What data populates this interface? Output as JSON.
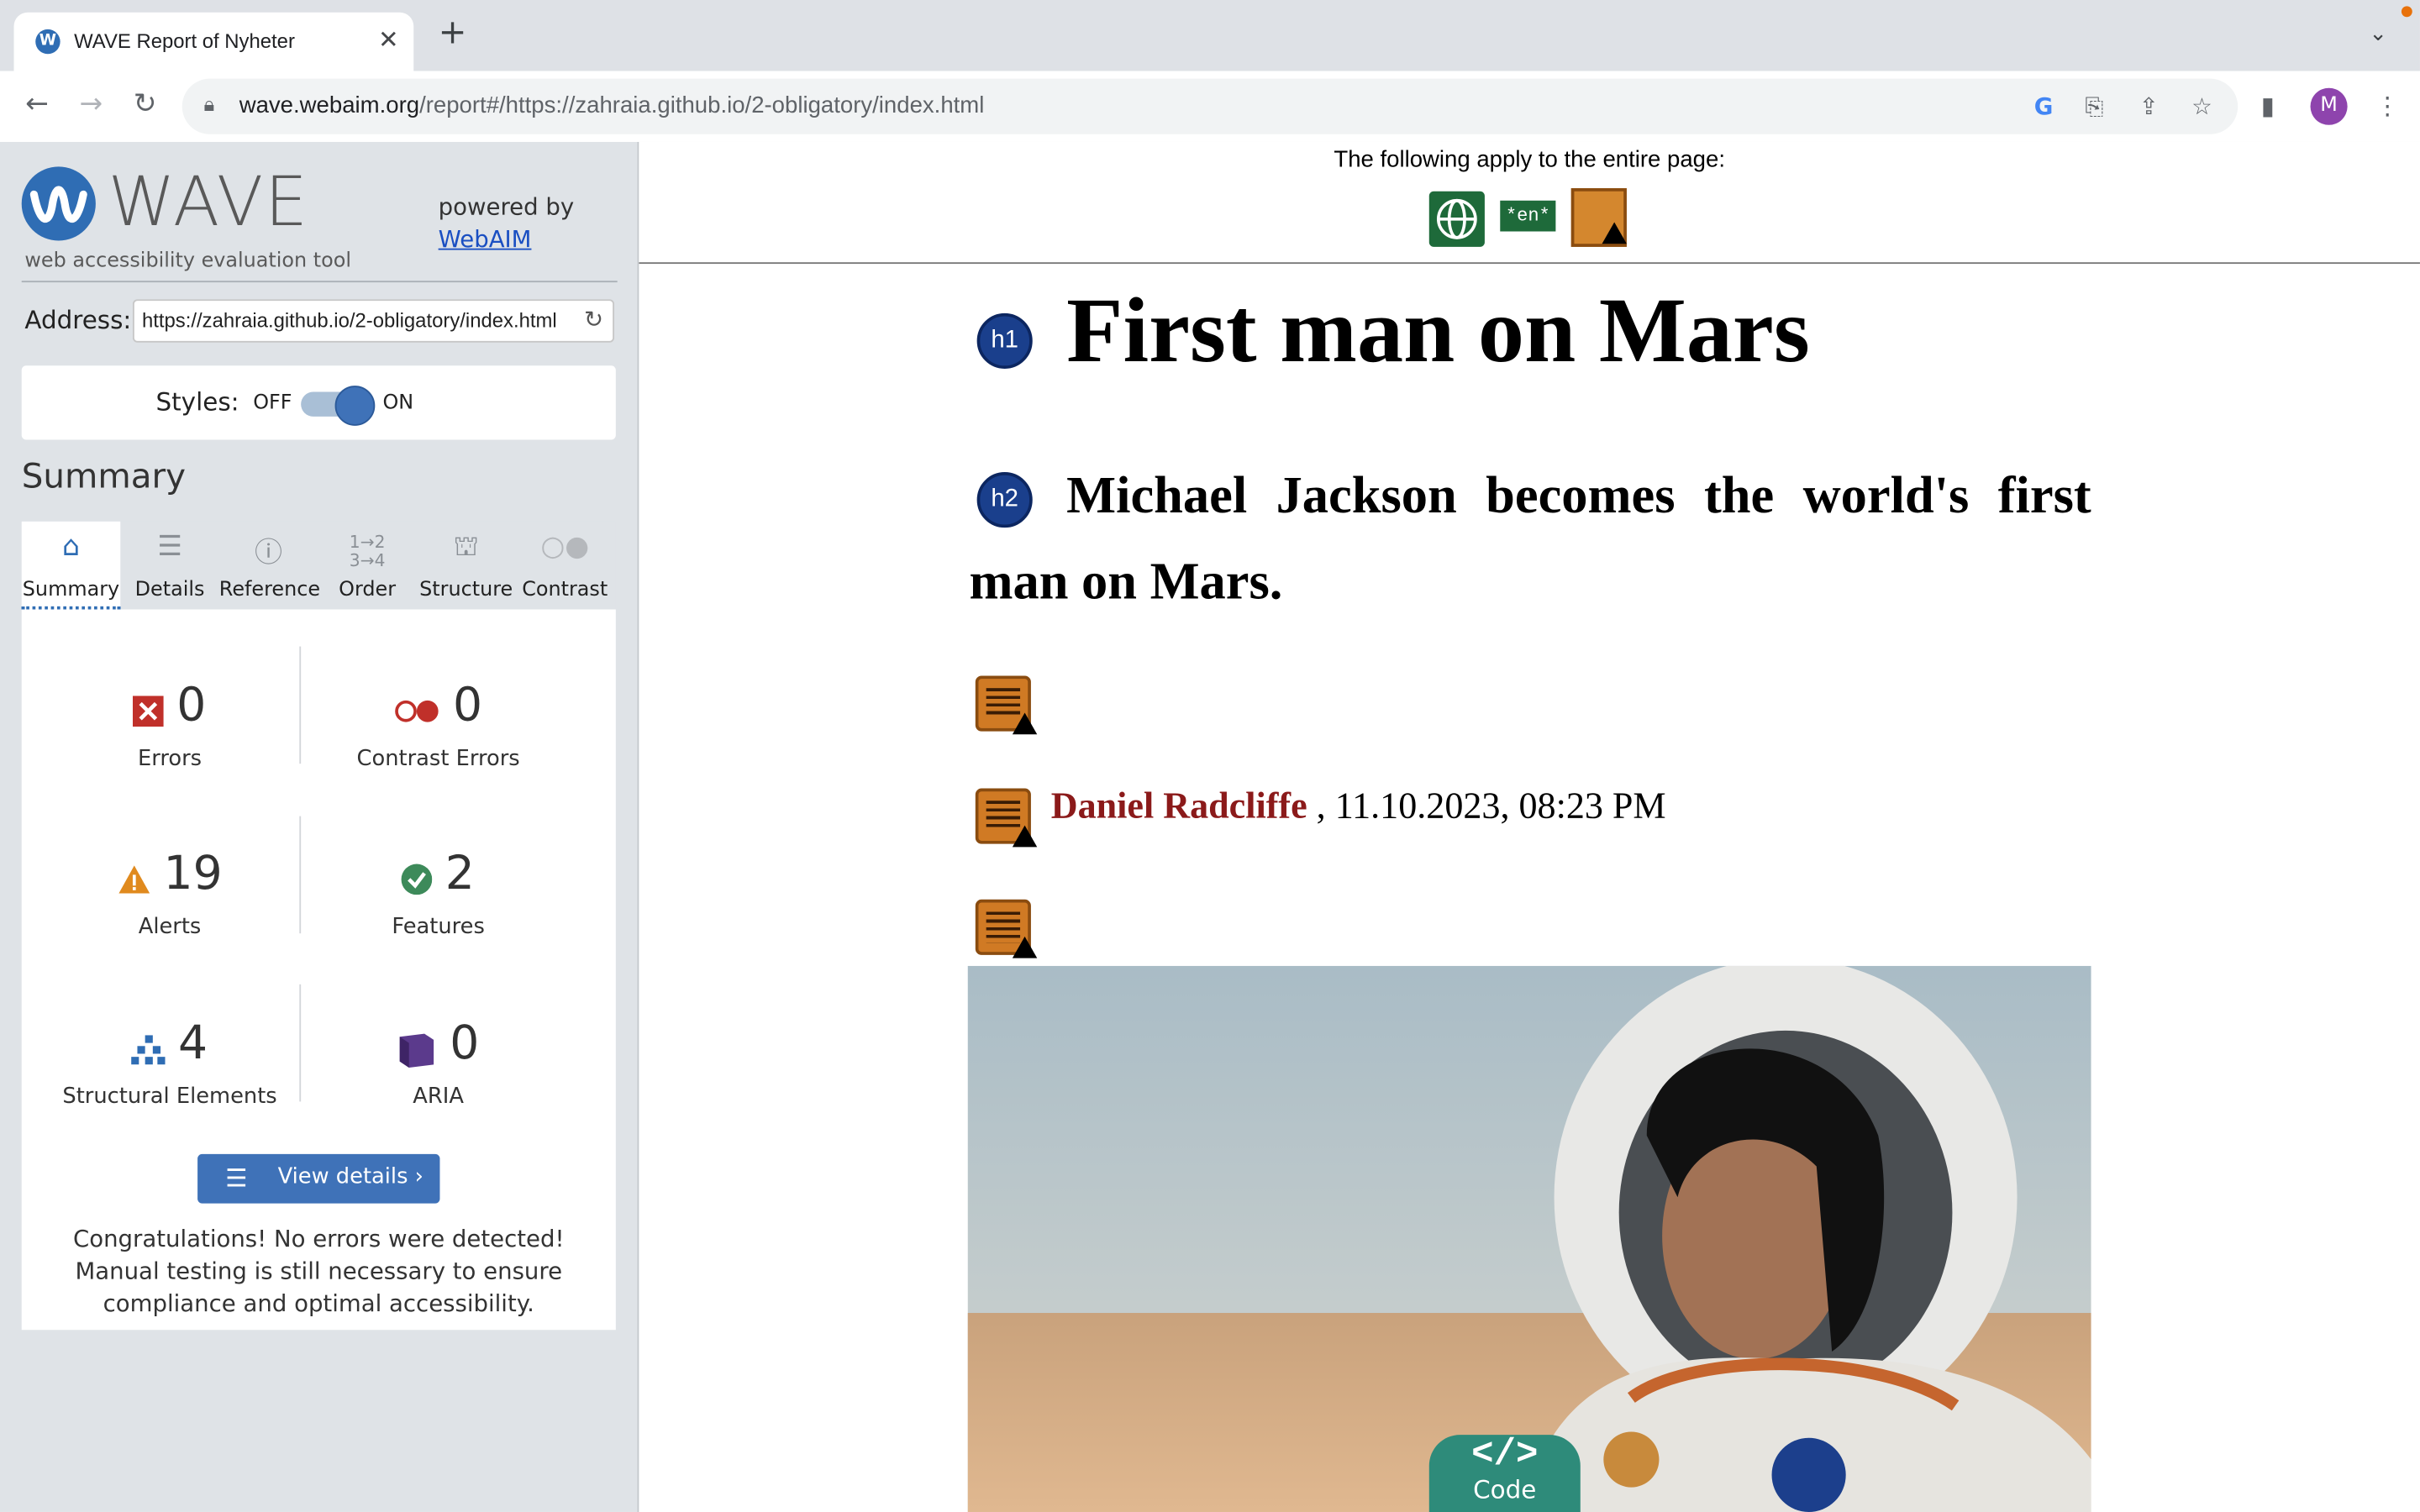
{
  "browser": {
    "tab_title": "WAVE Report of Nyheter",
    "url_host": "wave.webaim.org",
    "url_path": "/report#/https://zahraia.github.io/2-obligatory/index.html",
    "avatar_letter": "M"
  },
  "sidebar": {
    "logo": "WAVE",
    "logo_sub": "web accessibility evaluation tool",
    "powered_by": "powered by",
    "webaim_link": "WebAIM",
    "address_label": "Address:",
    "address_value": "https://zahraia.github.io/2-obligatory/index.html",
    "styles_label": "Styles:",
    "styles_off": "OFF",
    "styles_on": "ON",
    "summary_heading": "Summary",
    "tabs": [
      {
        "label": "Summary",
        "icon": "home-icon"
      },
      {
        "label": "Details",
        "icon": "list-icon"
      },
      {
        "label": "Reference",
        "icon": "info-icon"
      },
      {
        "label": "Order",
        "icon": "order-icon"
      },
      {
        "label": "Structure",
        "icon": "structure-icon"
      },
      {
        "label": "Contrast",
        "icon": "contrast-icon"
      }
    ],
    "stats": {
      "errors": {
        "value": "0",
        "label": "Errors"
      },
      "contrast_errors": {
        "value": "0",
        "label": "Contrast Errors"
      },
      "alerts": {
        "value": "19",
        "label": "Alerts"
      },
      "features": {
        "value": "2",
        "label": "Features"
      },
      "structural": {
        "value": "4",
        "label": "Structural Elements"
      },
      "aria": {
        "value": "0",
        "label": "ARIA"
      }
    },
    "view_details": "View details ›",
    "congrats": "Congratulations! No errors were detected! Manual testing is still necessary to ensure compliance and optimal accessibility."
  },
  "main": {
    "applies_text": "The following apply to the entire page:",
    "lang_badge": "*en*",
    "h1_badge": "h1",
    "h2_badge": "h2",
    "h1": "First man on Mars",
    "h2": "Michael Jackson becomes the world's first man on Mars.",
    "author": "Daniel Radcliffe",
    "date": " , 11.10.2023, 08:23 PM",
    "code_icon": "</>",
    "code_label": "Code"
  },
  "colors": {
    "wave_blue": "#2f6db4",
    "error_red": "#c0302a",
    "alert_orange": "#e08a1e",
    "feature_green": "#3d8a5a",
    "aria_purple": "#5b3a8c",
    "author_red": "#8b1a1a"
  }
}
